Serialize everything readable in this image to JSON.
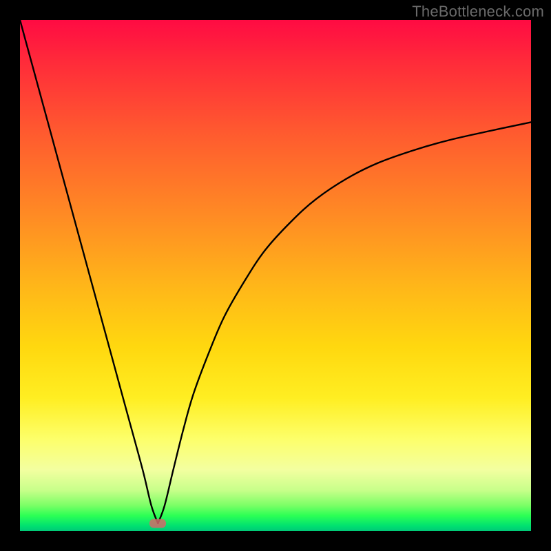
{
  "watermark": "TheBottleneck.com",
  "chart_data": {
    "type": "line",
    "title": "",
    "xlabel": "",
    "ylabel": "",
    "xlim": [
      0,
      100
    ],
    "ylim": [
      0,
      100
    ],
    "grid": false,
    "legend": false,
    "notes": "Axes have no visible tick labels or units; x/y are normalized 0-100. The curve is a V: a near-linear descending left branch and an asymptotic ascending right branch that plateaus near y≈80. A small red pill marker sits at the trough. Background is a vertical red→green gradient.",
    "marker": {
      "x": 27,
      "y": 1.5,
      "color": "#d26a6a"
    },
    "series": [
      {
        "name": "left-branch",
        "x": [
          0,
          3,
          6,
          9,
          12,
          15,
          18,
          21,
          24,
          25.7,
          27
        ],
        "values": [
          100,
          89,
          78,
          67,
          56,
          45,
          34,
          23,
          12,
          5,
          1.5
        ]
      },
      {
        "name": "right-branch",
        "x": [
          27,
          28.3,
          30,
          32,
          34,
          37,
          40,
          44,
          48,
          53,
          58,
          64,
          70,
          77,
          84,
          92,
          100
        ],
        "values": [
          1.5,
          5,
          12,
          20,
          27,
          35,
          42,
          49,
          55,
          60.5,
          65,
          69,
          72,
          74.5,
          76.5,
          78.3,
          80
        ]
      }
    ]
  }
}
